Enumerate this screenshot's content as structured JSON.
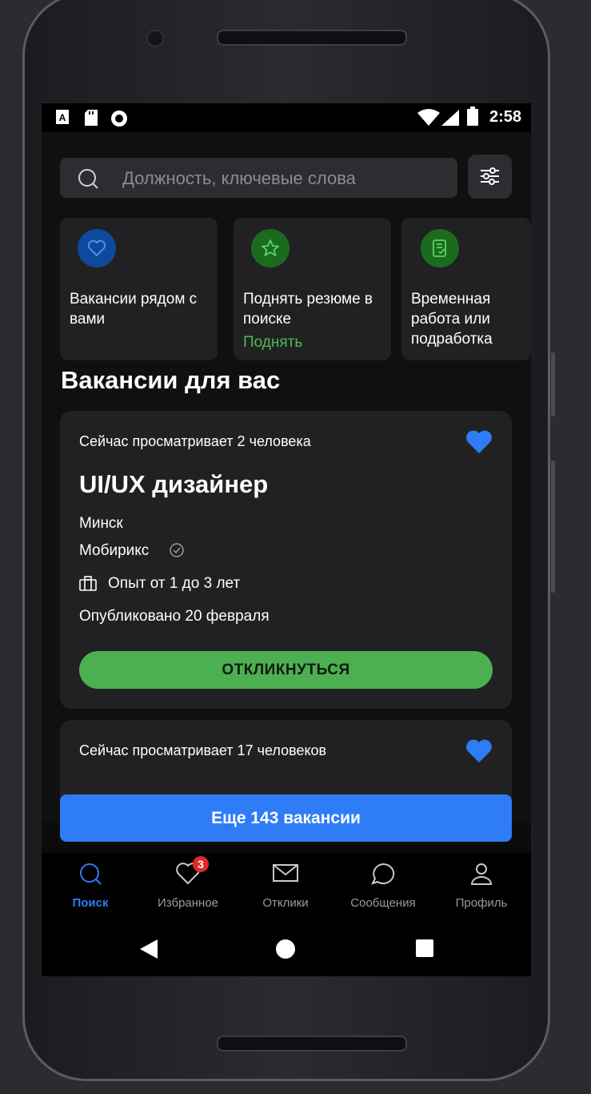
{
  "status_bar": {
    "time": "2:58",
    "icons": [
      "app-a-icon",
      "sd-card-icon",
      "record-icon",
      "wifi-icon",
      "signal-icon",
      "battery-icon"
    ]
  },
  "search": {
    "placeholder": "Должность, ключевые слова"
  },
  "quick_actions": [
    {
      "icon": "heart-icon",
      "icon_bg": "#0d4a9a",
      "text": "Вакансии рядом с вами"
    },
    {
      "icon": "star-icon",
      "icon_bg": "#1b6b1e",
      "text": "Поднять резюме в поиске",
      "link": "Поднять"
    },
    {
      "icon": "document-check-icon",
      "icon_bg": "#1b6b1e",
      "text": "Временная работа или подработка"
    }
  ],
  "section_title": "Вакансии для вас",
  "vacancies": [
    {
      "viewers": "Сейчас просматривает 2 человека",
      "title": "UI/UX дизайнер",
      "city": "Минск",
      "company": "Мобирикс",
      "experience": "Опыт от 1 до 3 лет",
      "published": "Опубликовано 20 февраля",
      "apply_label": "ОТКЛИКНУТЬСЯ"
    },
    {
      "viewers": "Сейчас просматривает 17 человеков"
    }
  ],
  "more_button": "Еще 143 вакансии",
  "tabs": [
    {
      "label": "Поиск",
      "icon": "search-icon",
      "active": true
    },
    {
      "label": "Избранное",
      "icon": "heart-icon",
      "badge": "3"
    },
    {
      "label": "Отклики",
      "icon": "envelope-icon"
    },
    {
      "label": "Сообщения",
      "icon": "chat-bubble-icon"
    },
    {
      "label": "Профиль",
      "icon": "person-icon"
    }
  ],
  "colors": {
    "accent_blue": "#2e7cf6",
    "accent_green": "#4cb050",
    "card_bg": "#212124",
    "badge_red": "#e02828"
  }
}
